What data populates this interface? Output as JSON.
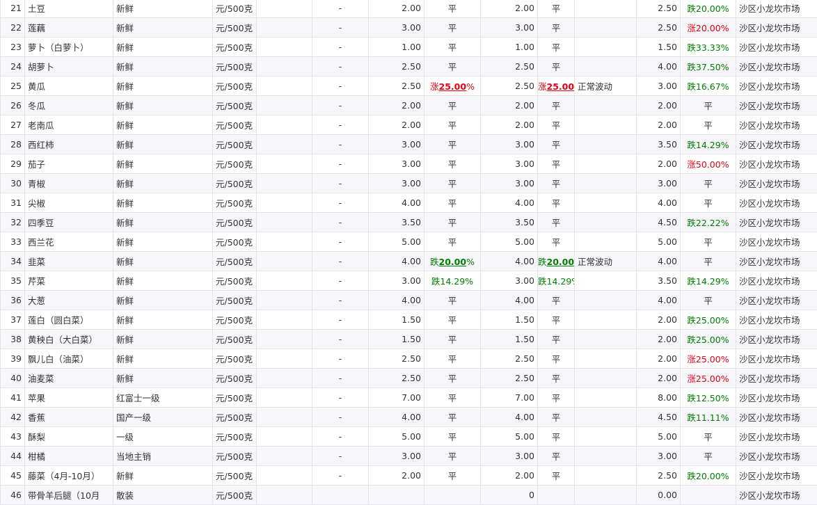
{
  "table": {
    "rows": [
      {
        "no": "21",
        "name": "土豆",
        "grade": "新鲜",
        "unit": "元/500克",
        "p1": "",
        "p2": "-",
        "p3": "2.00",
        "c1": {
          "t": "flat",
          "pre": "平",
          "big": "",
          "suf": ""
        },
        "p4": "2.00",
        "c2": {
          "t": "flat",
          "pre": "平",
          "big": "",
          "suf": ""
        },
        "note": "",
        "p5": "2.50",
        "c3": {
          "t": "down",
          "pre": "跌20.00%",
          "big": "",
          "suf": ""
        },
        "market": "沙区小龙坎市场"
      },
      {
        "no": "22",
        "name": "莲藕",
        "grade": "新鲜",
        "unit": "元/500克",
        "p1": "",
        "p2": "-",
        "p3": "3.00",
        "c1": {
          "t": "flat",
          "pre": "平",
          "big": "",
          "suf": ""
        },
        "p4": "3.00",
        "c2": {
          "t": "flat",
          "pre": "平",
          "big": "",
          "suf": ""
        },
        "note": "",
        "p5": "2.50",
        "c3": {
          "t": "up",
          "pre": "涨20.00%",
          "big": "",
          "suf": ""
        },
        "market": "沙区小龙坎市场"
      },
      {
        "no": "23",
        "name": "萝卜（白萝卜）",
        "grade": "新鲜",
        "unit": "元/500克",
        "p1": "",
        "p2": "-",
        "p3": "1.00",
        "c1": {
          "t": "flat",
          "pre": "平",
          "big": "",
          "suf": ""
        },
        "p4": "1.00",
        "c2": {
          "t": "flat",
          "pre": "平",
          "big": "",
          "suf": ""
        },
        "note": "",
        "p5": "1.50",
        "c3": {
          "t": "down",
          "pre": "跌33.33%",
          "big": "",
          "suf": ""
        },
        "market": "沙区小龙坎市场"
      },
      {
        "no": "24",
        "name": "胡萝卜",
        "grade": "新鲜",
        "unit": "元/500克",
        "p1": "",
        "p2": "-",
        "p3": "2.50",
        "c1": {
          "t": "flat",
          "pre": "平",
          "big": "",
          "suf": ""
        },
        "p4": "2.50",
        "c2": {
          "t": "flat",
          "pre": "平",
          "big": "",
          "suf": ""
        },
        "note": "",
        "p5": "4.00",
        "c3": {
          "t": "down",
          "pre": "跌37.50%",
          "big": "",
          "suf": ""
        },
        "market": "沙区小龙坎市场"
      },
      {
        "no": "25",
        "name": "黄瓜",
        "grade": "新鲜",
        "unit": "元/500克",
        "p1": "",
        "p2": "-",
        "p3": "2.50",
        "c1": {
          "t": "up",
          "pre": "涨",
          "big": "25.00",
          "suf": "%"
        },
        "p4": "2.50",
        "c2": {
          "t": "up",
          "pre": "涨",
          "big": "25.00",
          "suf": "%"
        },
        "note": "正常波动",
        "p5": "3.00",
        "c3": {
          "t": "down",
          "pre": "跌16.67%",
          "big": "",
          "suf": ""
        },
        "market": "沙区小龙坎市场"
      },
      {
        "no": "26",
        "name": "冬瓜",
        "grade": "新鲜",
        "unit": "元/500克",
        "p1": "",
        "p2": "-",
        "p3": "2.00",
        "c1": {
          "t": "flat",
          "pre": "平",
          "big": "",
          "suf": ""
        },
        "p4": "2.00",
        "c2": {
          "t": "flat",
          "pre": "平",
          "big": "",
          "suf": ""
        },
        "note": "",
        "p5": "2.00",
        "c3": {
          "t": "flat",
          "pre": "平",
          "big": "",
          "suf": ""
        },
        "market": "沙区小龙坎市场"
      },
      {
        "no": "27",
        "name": "老南瓜",
        "grade": "新鲜",
        "unit": "元/500克",
        "p1": "",
        "p2": "-",
        "p3": "2.00",
        "c1": {
          "t": "flat",
          "pre": "平",
          "big": "",
          "suf": ""
        },
        "p4": "2.00",
        "c2": {
          "t": "flat",
          "pre": "平",
          "big": "",
          "suf": ""
        },
        "note": "",
        "p5": "2.00",
        "c3": {
          "t": "flat",
          "pre": "平",
          "big": "",
          "suf": ""
        },
        "market": "沙区小龙坎市场"
      },
      {
        "no": "28",
        "name": "西红柿",
        "grade": "新鲜",
        "unit": "元/500克",
        "p1": "",
        "p2": "-",
        "p3": "3.00",
        "c1": {
          "t": "flat",
          "pre": "平",
          "big": "",
          "suf": ""
        },
        "p4": "3.00",
        "c2": {
          "t": "flat",
          "pre": "平",
          "big": "",
          "suf": ""
        },
        "note": "",
        "p5": "3.50",
        "c3": {
          "t": "down",
          "pre": "跌14.29%",
          "big": "",
          "suf": ""
        },
        "market": "沙区小龙坎市场"
      },
      {
        "no": "29",
        "name": "茄子",
        "grade": "新鲜",
        "unit": "元/500克",
        "p1": "",
        "p2": "-",
        "p3": "3.00",
        "c1": {
          "t": "flat",
          "pre": "平",
          "big": "",
          "suf": ""
        },
        "p4": "3.00",
        "c2": {
          "t": "flat",
          "pre": "平",
          "big": "",
          "suf": ""
        },
        "note": "",
        "p5": "2.00",
        "c3": {
          "t": "up",
          "pre": "涨50.00%",
          "big": "",
          "suf": ""
        },
        "market": "沙区小龙坎市场"
      },
      {
        "no": "30",
        "name": "青椒",
        "grade": "新鲜",
        "unit": "元/500克",
        "p1": "",
        "p2": "-",
        "p3": "3.00",
        "c1": {
          "t": "flat",
          "pre": "平",
          "big": "",
          "suf": ""
        },
        "p4": "3.00",
        "c2": {
          "t": "flat",
          "pre": "平",
          "big": "",
          "suf": ""
        },
        "note": "",
        "p5": "3.00",
        "c3": {
          "t": "flat",
          "pre": "平",
          "big": "",
          "suf": ""
        },
        "market": "沙区小龙坎市场"
      },
      {
        "no": "31",
        "name": "尖椒",
        "grade": "新鲜",
        "unit": "元/500克",
        "p1": "",
        "p2": "-",
        "p3": "4.00",
        "c1": {
          "t": "flat",
          "pre": "平",
          "big": "",
          "suf": ""
        },
        "p4": "4.00",
        "c2": {
          "t": "flat",
          "pre": "平",
          "big": "",
          "suf": ""
        },
        "note": "",
        "p5": "4.00",
        "c3": {
          "t": "flat",
          "pre": "平",
          "big": "",
          "suf": ""
        },
        "market": "沙区小龙坎市场"
      },
      {
        "no": "32",
        "name": "四季豆",
        "grade": "新鲜",
        "unit": "元/500克",
        "p1": "",
        "p2": "-",
        "p3": "3.50",
        "c1": {
          "t": "flat",
          "pre": "平",
          "big": "",
          "suf": ""
        },
        "p4": "3.50",
        "c2": {
          "t": "flat",
          "pre": "平",
          "big": "",
          "suf": ""
        },
        "note": "",
        "p5": "4.50",
        "c3": {
          "t": "down",
          "pre": "跌22.22%",
          "big": "",
          "suf": ""
        },
        "market": "沙区小龙坎市场"
      },
      {
        "no": "33",
        "name": "西兰花",
        "grade": "新鲜",
        "unit": "元/500克",
        "p1": "",
        "p2": "-",
        "p3": "5.00",
        "c1": {
          "t": "flat",
          "pre": "平",
          "big": "",
          "suf": ""
        },
        "p4": "5.00",
        "c2": {
          "t": "flat",
          "pre": "平",
          "big": "",
          "suf": ""
        },
        "note": "",
        "p5": "5.00",
        "c3": {
          "t": "flat",
          "pre": "平",
          "big": "",
          "suf": ""
        },
        "market": "沙区小龙坎市场"
      },
      {
        "no": "34",
        "name": "韭菜",
        "grade": "新鲜",
        "unit": "元/500克",
        "p1": "",
        "p2": "-",
        "p3": "4.00",
        "c1": {
          "t": "down",
          "pre": "跌",
          "big": "20.00",
          "suf": "%"
        },
        "p4": "4.00",
        "c2": {
          "t": "down",
          "pre": "跌",
          "big": "20.00",
          "suf": "%"
        },
        "note": "正常波动",
        "p5": "4.00",
        "c3": {
          "t": "flat",
          "pre": "平",
          "big": "",
          "suf": ""
        },
        "market": "沙区小龙坎市场"
      },
      {
        "no": "35",
        "name": "芹菜",
        "grade": "新鲜",
        "unit": "元/500克",
        "p1": "",
        "p2": "-",
        "p3": "3.00",
        "c1": {
          "t": "down",
          "pre": "跌14.29%",
          "big": "",
          "suf": ""
        },
        "p4": "3.00",
        "c2": {
          "t": "down",
          "pre": "跌14.29%",
          "big": "",
          "suf": ""
        },
        "note": "",
        "p5": "3.50",
        "c3": {
          "t": "down",
          "pre": "跌14.29%",
          "big": "",
          "suf": ""
        },
        "market": "沙区小龙坎市场"
      },
      {
        "no": "36",
        "name": "大葱",
        "grade": "新鲜",
        "unit": "元/500克",
        "p1": "",
        "p2": "-",
        "p3": "4.00",
        "c1": {
          "t": "flat",
          "pre": "平",
          "big": "",
          "suf": ""
        },
        "p4": "4.00",
        "c2": {
          "t": "flat",
          "pre": "平",
          "big": "",
          "suf": ""
        },
        "note": "",
        "p5": "4.00",
        "c3": {
          "t": "flat",
          "pre": "平",
          "big": "",
          "suf": ""
        },
        "market": "沙区小龙坎市场"
      },
      {
        "no": "37",
        "name": "莲白（圆白菜）",
        "grade": "新鲜",
        "unit": "元/500克",
        "p1": "",
        "p2": "-",
        "p3": "1.50",
        "c1": {
          "t": "flat",
          "pre": "平",
          "big": "",
          "suf": ""
        },
        "p4": "1.50",
        "c2": {
          "t": "flat",
          "pre": "平",
          "big": "",
          "suf": ""
        },
        "note": "",
        "p5": "2.00",
        "c3": {
          "t": "down",
          "pre": "跌25.00%",
          "big": "",
          "suf": ""
        },
        "market": "沙区小龙坎市场"
      },
      {
        "no": "38",
        "name": "黄秧白（大白菜）",
        "grade": "新鲜",
        "unit": "元/500克",
        "p1": "",
        "p2": "-",
        "p3": "1.50",
        "c1": {
          "t": "flat",
          "pre": "平",
          "big": "",
          "suf": ""
        },
        "p4": "1.50",
        "c2": {
          "t": "flat",
          "pre": "平",
          "big": "",
          "suf": ""
        },
        "note": "",
        "p5": "2.00",
        "c3": {
          "t": "down",
          "pre": "跌25.00%",
          "big": "",
          "suf": ""
        },
        "market": "沙区小龙坎市场"
      },
      {
        "no": "39",
        "name": "飘儿白（油菜）",
        "grade": "新鲜",
        "unit": "元/500克",
        "p1": "",
        "p2": "-",
        "p3": "2.50",
        "c1": {
          "t": "flat",
          "pre": "平",
          "big": "",
          "suf": ""
        },
        "p4": "2.50",
        "c2": {
          "t": "flat",
          "pre": "平",
          "big": "",
          "suf": ""
        },
        "note": "",
        "p5": "2.00",
        "c3": {
          "t": "up",
          "pre": "涨25.00%",
          "big": "",
          "suf": ""
        },
        "market": "沙区小龙坎市场"
      },
      {
        "no": "40",
        "name": "油麦菜",
        "grade": "新鲜",
        "unit": "元/500克",
        "p1": "",
        "p2": "-",
        "p3": "2.50",
        "c1": {
          "t": "flat",
          "pre": "平",
          "big": "",
          "suf": ""
        },
        "p4": "2.50",
        "c2": {
          "t": "flat",
          "pre": "平",
          "big": "",
          "suf": ""
        },
        "note": "",
        "p5": "2.00",
        "c3": {
          "t": "up",
          "pre": "涨25.00%",
          "big": "",
          "suf": ""
        },
        "market": "沙区小龙坎市场"
      },
      {
        "no": "41",
        "name": "苹果",
        "grade": "红富士一级",
        "unit": "元/500克",
        "p1": "",
        "p2": "-",
        "p3": "7.00",
        "c1": {
          "t": "flat",
          "pre": "平",
          "big": "",
          "suf": ""
        },
        "p4": "7.00",
        "c2": {
          "t": "flat",
          "pre": "平",
          "big": "",
          "suf": ""
        },
        "note": "",
        "p5": "8.00",
        "c3": {
          "t": "down",
          "pre": "跌12.50%",
          "big": "",
          "suf": ""
        },
        "market": "沙区小龙坎市场"
      },
      {
        "no": "42",
        "name": "香蕉",
        "grade": "国产一级",
        "unit": "元/500克",
        "p1": "",
        "p2": "-",
        "p3": "4.00",
        "c1": {
          "t": "flat",
          "pre": "平",
          "big": "",
          "suf": ""
        },
        "p4": "4.00",
        "c2": {
          "t": "flat",
          "pre": "平",
          "big": "",
          "suf": ""
        },
        "note": "",
        "p5": "4.50",
        "c3": {
          "t": "down",
          "pre": "跌11.11%",
          "big": "",
          "suf": ""
        },
        "market": "沙区小龙坎市场"
      },
      {
        "no": "43",
        "name": "酥梨",
        "grade": "一级",
        "unit": "元/500克",
        "p1": "",
        "p2": "-",
        "p3": "5.00",
        "c1": {
          "t": "flat",
          "pre": "平",
          "big": "",
          "suf": ""
        },
        "p4": "5.00",
        "c2": {
          "t": "flat",
          "pre": "平",
          "big": "",
          "suf": ""
        },
        "note": "",
        "p5": "5.00",
        "c3": {
          "t": "flat",
          "pre": "平",
          "big": "",
          "suf": ""
        },
        "market": "沙区小龙坎市场"
      },
      {
        "no": "44",
        "name": "柑橘",
        "grade": "当地主销",
        "unit": "元/500克",
        "p1": "",
        "p2": "-",
        "p3": "3.00",
        "c1": {
          "t": "flat",
          "pre": "平",
          "big": "",
          "suf": ""
        },
        "p4": "3.00",
        "c2": {
          "t": "flat",
          "pre": "平",
          "big": "",
          "suf": ""
        },
        "note": "",
        "p5": "3.00",
        "c3": {
          "t": "flat",
          "pre": "平",
          "big": "",
          "suf": ""
        },
        "market": "沙区小龙坎市场"
      },
      {
        "no": "45",
        "name": "藤菜（4月-10月）",
        "grade": "新鲜",
        "unit": "元/500克",
        "p1": "",
        "p2": "-",
        "p3": "2.00",
        "c1": {
          "t": "flat",
          "pre": "平",
          "big": "",
          "suf": ""
        },
        "p4": "2.00",
        "c2": {
          "t": "flat",
          "pre": "平",
          "big": "",
          "suf": ""
        },
        "note": "",
        "p5": "2.50",
        "c3": {
          "t": "down",
          "pre": "跌20.00%",
          "big": "",
          "suf": ""
        },
        "market": "沙区小龙坎市场"
      },
      {
        "no": "46",
        "name": "带骨羊后腿（10月",
        "grade": "散装",
        "unit": "元/500克",
        "p1": "",
        "p2": "",
        "p3": "",
        "c1": {
          "t": "flat",
          "pre": "",
          "big": "",
          "suf": ""
        },
        "p4": "0",
        "c2": {
          "t": "flat",
          "pre": "",
          "big": "",
          "suf": ""
        },
        "note": "",
        "p5": "0.00",
        "c3": {
          "t": "flat",
          "pre": "",
          "big": "",
          "suf": ""
        },
        "market": "沙区小龙坎市场"
      }
    ]
  }
}
